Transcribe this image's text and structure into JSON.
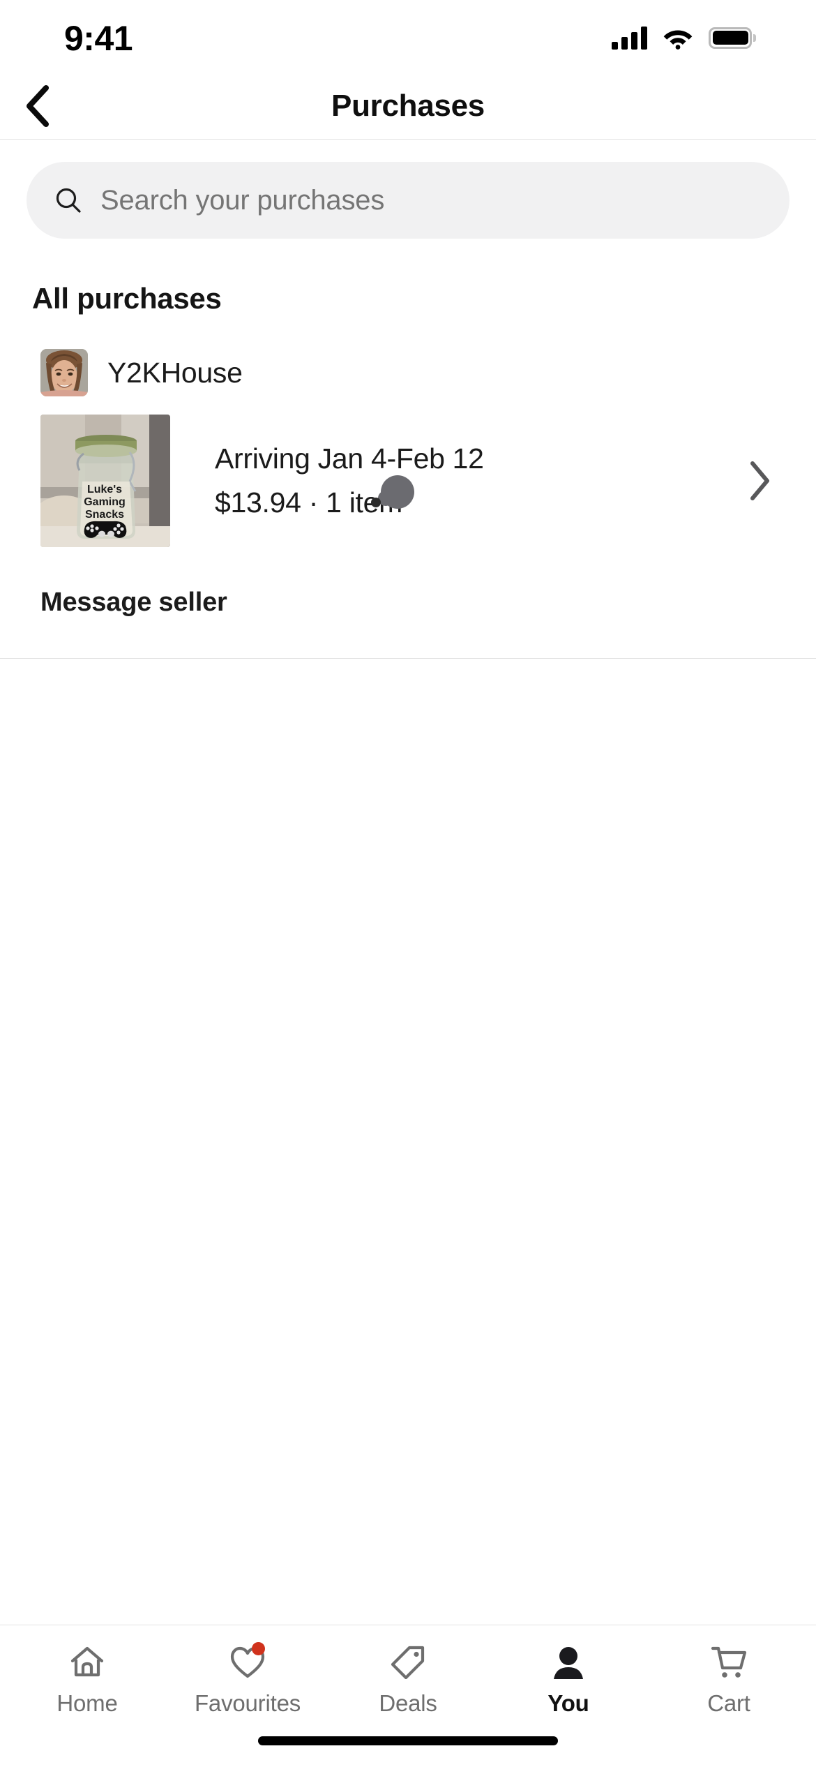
{
  "status_bar": {
    "time": "9:41",
    "signal_icon": "cellular-signal-icon",
    "wifi_icon": "wifi-icon",
    "battery_icon": "battery-full-icon"
  },
  "nav": {
    "back_icon": "chevron-left-icon",
    "title": "Purchases"
  },
  "search": {
    "icon": "search-icon",
    "placeholder": "Search your purchases",
    "value": ""
  },
  "main": {
    "section_title": "All purchases",
    "orders": [
      {
        "seller_name": "Y2KHouse",
        "seller_avatar": "seller-avatar-photo",
        "product_image": "product-photo-gaming-snacks-jar",
        "product_image_text": "Luke's Gaming Snacks",
        "delivery_status": "Arriving Jan 4-Feb 12",
        "price": "$13.94",
        "item_count": "1 item",
        "price_and_count": "$13.94 · 1 item",
        "chevron_icon": "chevron-right-icon",
        "message_seller_label": "Message seller"
      }
    ]
  },
  "tab_bar": {
    "items": [
      {
        "label": "Home",
        "icon": "home-icon",
        "active": false,
        "badge": false
      },
      {
        "label": "Favourites",
        "icon": "heart-icon",
        "active": false,
        "badge": true
      },
      {
        "label": "Deals",
        "icon": "tag-icon",
        "active": false,
        "badge": false
      },
      {
        "label": "You",
        "icon": "person-icon",
        "active": true,
        "badge": false
      },
      {
        "label": "Cart",
        "icon": "shopping-cart-icon",
        "active": false,
        "badge": false
      }
    ]
  },
  "colors": {
    "accent_badge": "#d0321c",
    "search_background": "#f1f1f2",
    "text_primary": "#1b1b1b",
    "text_muted": "#6e6e6e",
    "divider": "#e3e3e3"
  },
  "home_indicator": "home-indicator"
}
